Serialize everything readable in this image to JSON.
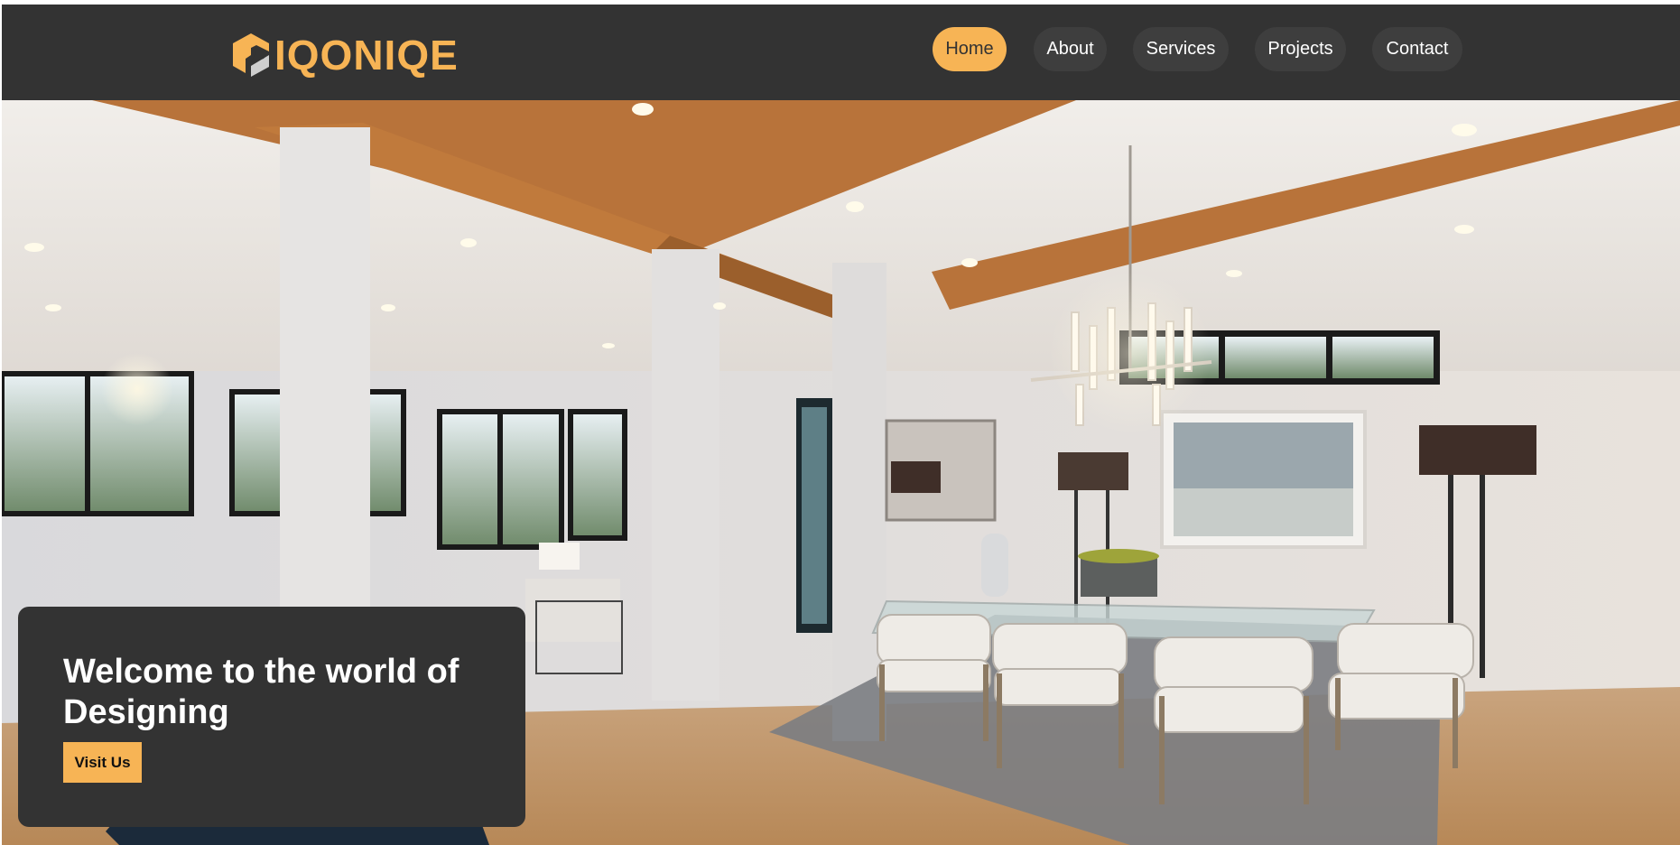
{
  "brand": {
    "name": "IQONIQE",
    "accent_color": "#f7b455",
    "nav_bg": "#333333"
  },
  "nav": {
    "items": [
      {
        "label": "Home",
        "active": true
      },
      {
        "label": "About",
        "active": false
      },
      {
        "label": "Services",
        "active": false
      },
      {
        "label": "Projects",
        "active": false
      },
      {
        "label": "Contact",
        "active": false
      }
    ]
  },
  "hero": {
    "image_alt": "",
    "title": "Welcome to the world of Designing",
    "button_label": "Visit Us"
  }
}
